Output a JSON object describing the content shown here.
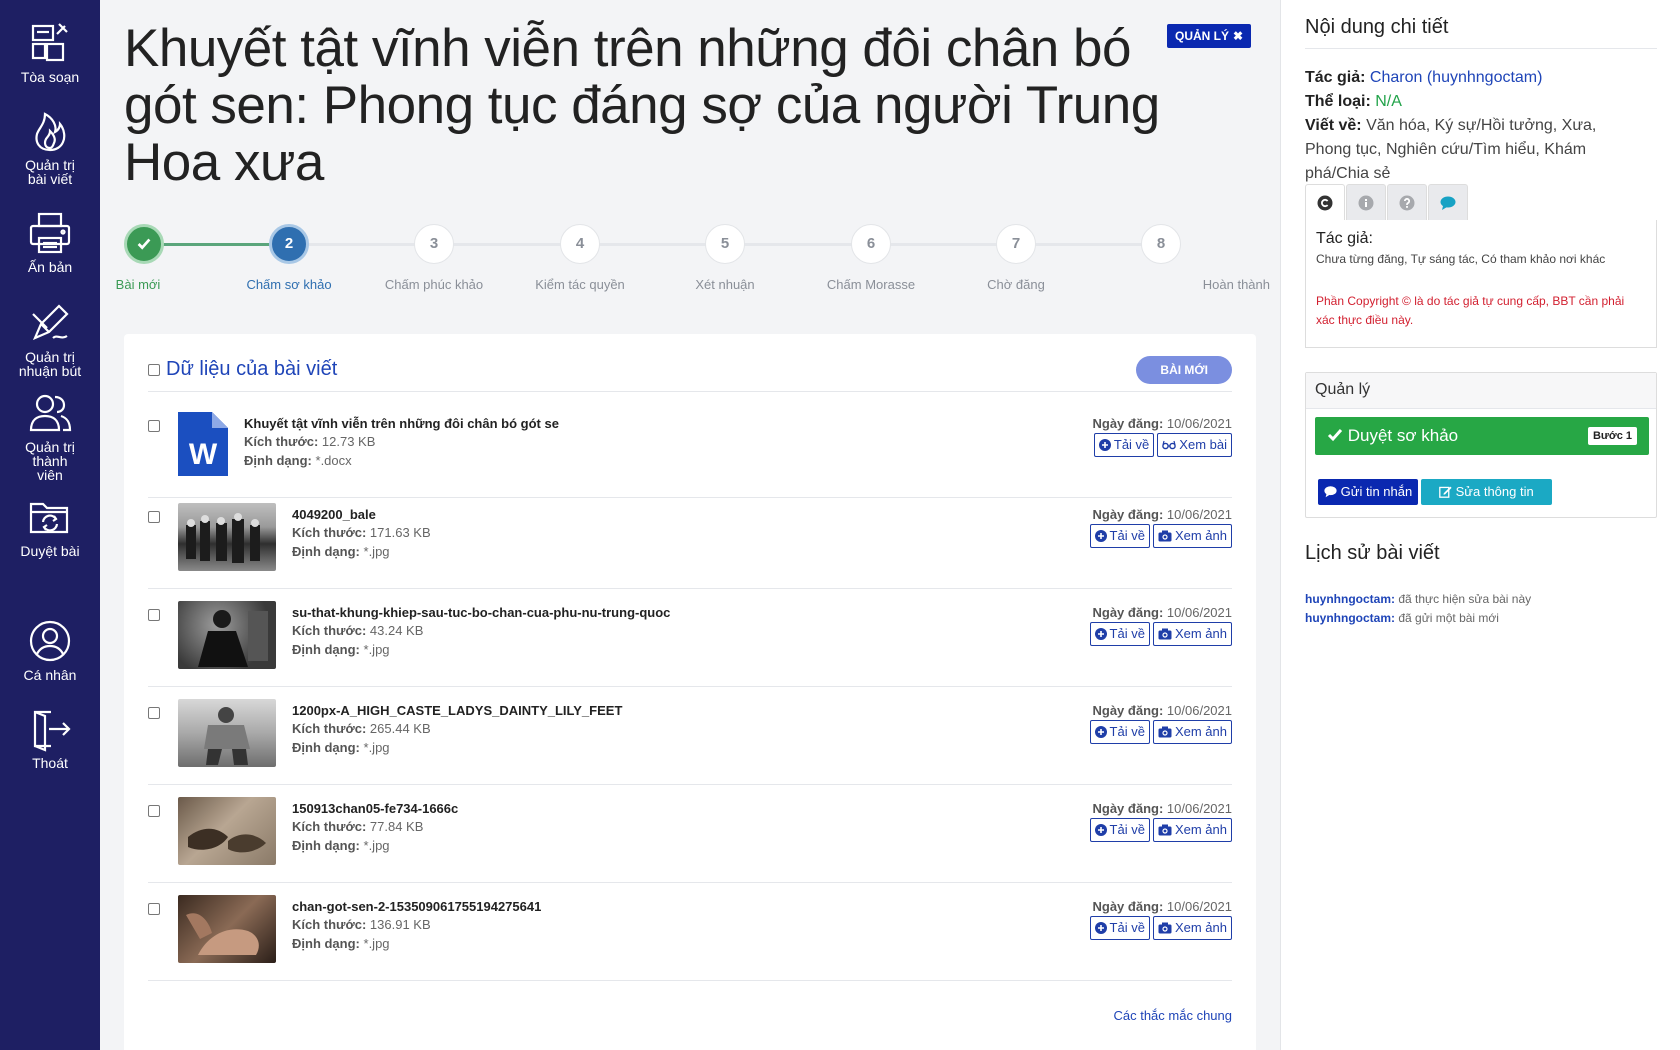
{
  "sidebar": {
    "items": [
      {
        "label": "Tòa soạn",
        "icon": "newsroom-icon"
      },
      {
        "label": "Quản trị\nbài viết",
        "icon": "fire-icon"
      },
      {
        "label": "Ấn bản",
        "icon": "printer-icon"
      },
      {
        "label": "Quản trị\nnhuận bút",
        "icon": "pen-icon"
      },
      {
        "label": "Quản trị\nthành\nviên",
        "icon": "users-icon"
      },
      {
        "label": "Duyệt bài",
        "icon": "folder-sync-icon"
      },
      {
        "label": "Cá nhân",
        "icon": "user-icon"
      },
      {
        "label": "Thoát",
        "icon": "logout-icon"
      }
    ]
  },
  "article": {
    "title": "Khuyết tật vĩnh viễn trên những đôi chân bó gót sen: Phong tục đáng sợ của người Trung Hoa xưa",
    "admin_label": "QUẢN LÝ"
  },
  "steps": [
    {
      "num": "",
      "label": "Bài mới",
      "state": "done"
    },
    {
      "num": "2",
      "label": "Chấm sơ khảo",
      "state": "current"
    },
    {
      "num": "3",
      "label": "Chấm phúc khảo",
      "state": "todo"
    },
    {
      "num": "4",
      "label": "Kiểm tác quyền",
      "state": "todo"
    },
    {
      "num": "5",
      "label": "Xét nhuận",
      "state": "todo"
    },
    {
      "num": "6",
      "label": "Chấm Morasse",
      "state": "todo"
    },
    {
      "num": "7",
      "label": "Chờ đăng",
      "state": "todo"
    },
    {
      "num": "8",
      "label": "Hoàn thành",
      "state": "todo"
    }
  ],
  "card": {
    "title": "Dữ liệu của bài viết",
    "badge": "BÀI MỚI",
    "size_label": "Kích thước:",
    "format_label": "Định dạng:",
    "date_label": "Ngày đăng:",
    "download_label": "Tải về",
    "faq": "Các thắc mắc chung",
    "files": [
      {
        "name": "Khuyết tật vĩnh viễn trên những đôi chân bó gót se",
        "size": "12.73 KB",
        "format": "*.docx",
        "date": "10/06/2021",
        "view_label": "Xem bài",
        "kind": "doc"
      },
      {
        "name": "4049200_bale",
        "size": "171.63 KB",
        "format": "*.jpg",
        "date": "10/06/2021",
        "view_label": "Xem ảnh",
        "kind": "img"
      },
      {
        "name": "su-that-khung-khiep-sau-tuc-bo-chan-cua-phu-nu-trung-quoc",
        "size": "43.24 KB",
        "format": "*.jpg",
        "date": "10/06/2021",
        "view_label": "Xem ảnh",
        "kind": "img"
      },
      {
        "name": "1200px-A_HIGH_CASTE_LADYS_DAINTY_LILY_FEET",
        "size": "265.44 KB",
        "format": "*.jpg",
        "date": "10/06/2021",
        "view_label": "Xem ảnh",
        "kind": "img"
      },
      {
        "name": "150913chan05-fe734-1666c",
        "size": "77.84 KB",
        "format": "*.jpg",
        "date": "10/06/2021",
        "view_label": "Xem ảnh",
        "kind": "img"
      },
      {
        "name": "chan-got-sen-2-153509061755194275641",
        "size": "136.91 KB",
        "format": "*.jpg",
        "date": "10/06/2021",
        "view_label": "Xem ảnh",
        "kind": "img"
      }
    ]
  },
  "details": {
    "heading": "Nội dung chi tiết",
    "author_label": "Tác giả:",
    "author_value": "Charon (huynhngoctam)",
    "type_label": "Thể loại:",
    "type_value": "N/A",
    "about_label": "Viết về:",
    "about_value": "Văn hóa, Ký sự/Hồi tưởng, Xưa, Phong tục, Nghiên cứu/Tìm hiểu, Khám phá/Chia sẻ",
    "tab_title": "Tác giả:",
    "tab_sub": "Chưa từng đăng, Tự sáng tác, Có tham khảo nơi khác",
    "tab_warning": "Phần Copyright © là do tác giả tự cung cấp, BBT cần phải xác thực điều này."
  },
  "management": {
    "heading": "Quản lý",
    "approve_label": "Duyệt sơ khảo",
    "step_pill": "Bước 1",
    "message_label": "Gửi tin nhắn",
    "edit_label": "Sửa thông tin"
  },
  "history": {
    "heading": "Lịch sử bài viết",
    "entries": [
      {
        "user": "huynhngoctam:",
        "action": "đã thực hiện sửa bài này"
      },
      {
        "user": "huynhngoctam:",
        "action": "đã gửi một bài mới"
      }
    ]
  },
  "colors": {
    "sidebar": "#1e1f63",
    "primary": "#0a28b0",
    "success": "#27a745",
    "info": "#1ba9c4",
    "danger": "#d21f2f",
    "step_current": "#2f6fb0"
  }
}
